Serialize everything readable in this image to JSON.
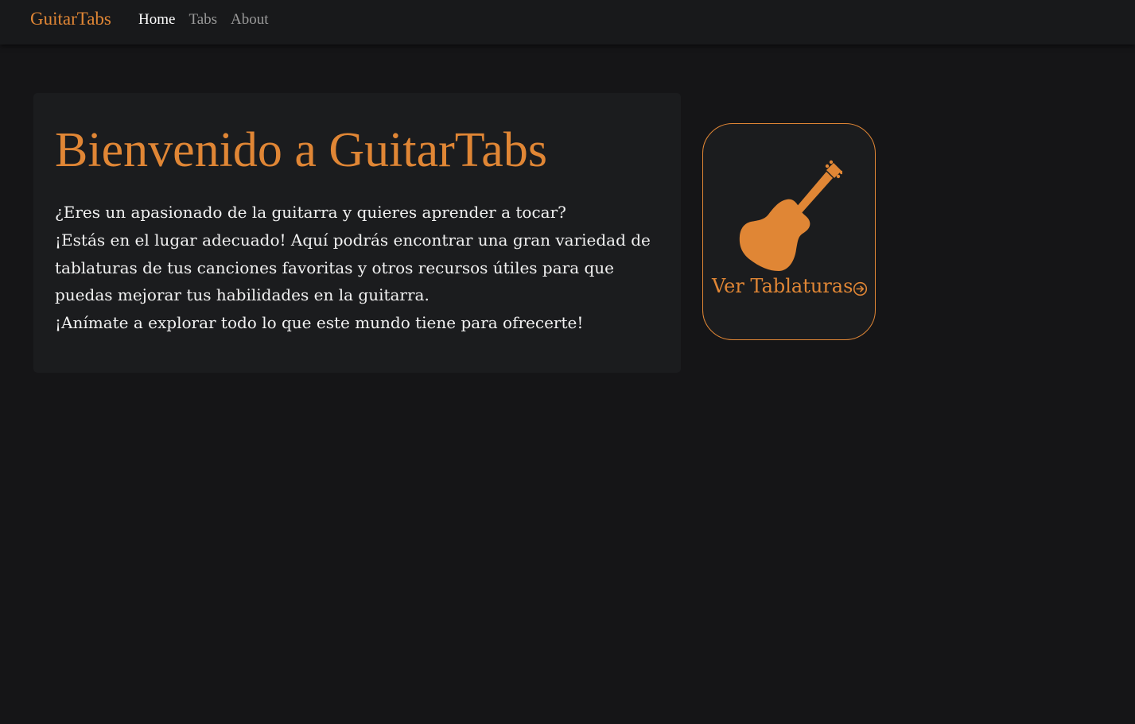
{
  "nav": {
    "brand": "GuitarTabs",
    "links": [
      {
        "label": "Home",
        "active": true
      },
      {
        "label": "Tabs",
        "active": false
      },
      {
        "label": "About",
        "active": false
      }
    ]
  },
  "hero": {
    "title": "Bienvenido a GuitarTabs",
    "paragraph": [
      "¿Eres un apasionado de la guitarra y quieres aprender a tocar?",
      "¡Estás en el lugar adecuado! Aquí podrás encontrar una gran variedad de tablaturas de tus canciones favoritas y otros recursos útiles para que puedas mejorar tus habilidades en la guitarra.",
      "¡Anímate a explorar todo lo que este mundo tiene para ofrecerte!"
    ]
  },
  "card": {
    "icon": "guitar-icon",
    "label": "Ver Tablaturas",
    "arrow_icon": "arrow-right-circle-icon"
  },
  "colors": {
    "accent": "#e08635",
    "background": "#151517",
    "surface": "#1b1c1e",
    "navbar": "#18191b",
    "text": "#f2f2f2",
    "muted": "#9a9a9a"
  }
}
